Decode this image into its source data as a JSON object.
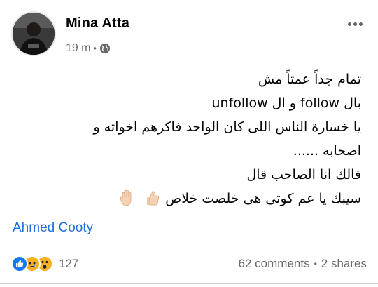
{
  "post": {
    "author": "Mina Atta",
    "time": "19 m",
    "privacy_icon": "globe-icon",
    "more_icon": "more-horizontal-icon",
    "lines": [
      "تمام جداً عمتاً مش",
      "بال follow و ال unfollow",
      "يا خسارة الناس اللى كان الواحد فاكرهم اخواته و",
      "اصحابه ......",
      "قالك انا الصاحب قال",
      "سيبك يا عم كوتى هى خلصت خلاص"
    ],
    "line6_emojis": [
      "thumbs-up-emoji",
      "raised-hand-emoji"
    ],
    "mention": "Ahmed Cooty"
  },
  "footer": {
    "reactions": [
      "like-reaction-icon",
      "sad-reaction-icon",
      "wow-reaction-icon"
    ],
    "reaction_count": "127",
    "comments": "62 comments",
    "separator": "•",
    "shares": "2 shares"
  },
  "colors": {
    "link": "#216fdb",
    "muted": "#65676b",
    "like_blue": "#1877f2",
    "reaction_yellow": "#f7b125"
  }
}
